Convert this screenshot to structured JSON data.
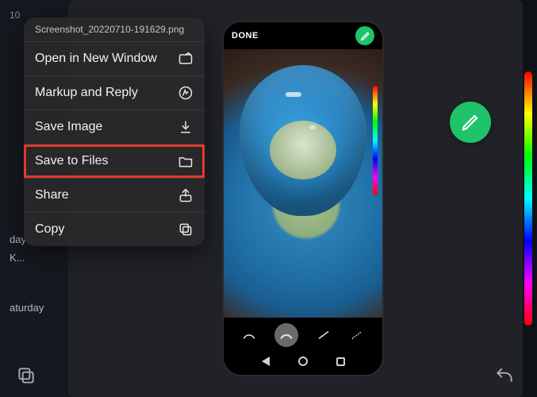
{
  "left_sidebar": {
    "rows": [
      "10",
      "day",
      "K...",
      "aturday"
    ]
  },
  "context_menu": {
    "filename": "Screenshot_20220710-191629.png",
    "items": [
      {
        "label": "Open in New Window",
        "icon": "new-window-icon"
      },
      {
        "label": "Markup and Reply",
        "icon": "markup-icon"
      },
      {
        "label": "Save Image",
        "icon": "download-icon"
      },
      {
        "label": "Save to Files",
        "icon": "folder-icon",
        "highlight": true
      },
      {
        "label": "Share",
        "icon": "share-icon"
      },
      {
        "label": "Copy",
        "icon": "copy-icon"
      }
    ]
  },
  "phone": {
    "done_label": "DONE"
  },
  "colors": {
    "accent_green": "#1ec36a",
    "highlight_red": "#e03a2f"
  }
}
